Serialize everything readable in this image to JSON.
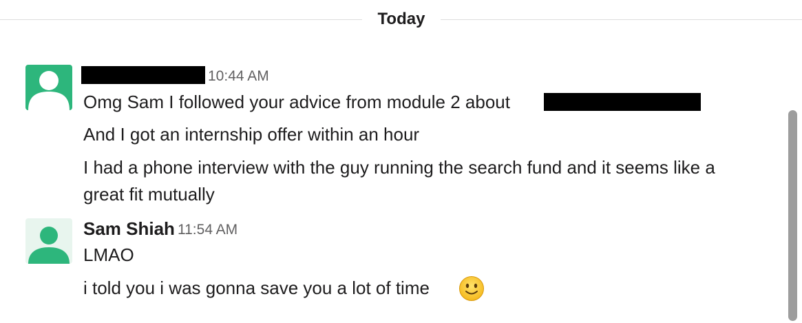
{
  "divider": {
    "label": "Today"
  },
  "messages": [
    {
      "sender": "",
      "sender_redacted": true,
      "time": "10:44 AM",
      "avatar": "user-silhouette-icon",
      "avatar_color": "#2db67c",
      "lines": [
        "Omg Sam I followed your advice from module 2 about",
        "And I got an internship offer within an hour",
        "I had a phone interview with the guy running the search fund and it seems like a",
        "great fit mutually"
      ]
    },
    {
      "sender": "Sam Shiah",
      "time": "11:54 AM",
      "avatar": "user-silhouette-icon",
      "avatar_color": "#2db67c",
      "lines": [
        "LMAO",
        "i told you i was gonna save you a lot of time"
      ],
      "emoji": "slightly-smiling-face-icon"
    }
  ],
  "colors": {
    "avatar_green": "#2db67c",
    "text": "#1d1c1d",
    "timestamp": "#616061",
    "divider": "#dddddd",
    "scrollbar": "#9d9d9d"
  }
}
